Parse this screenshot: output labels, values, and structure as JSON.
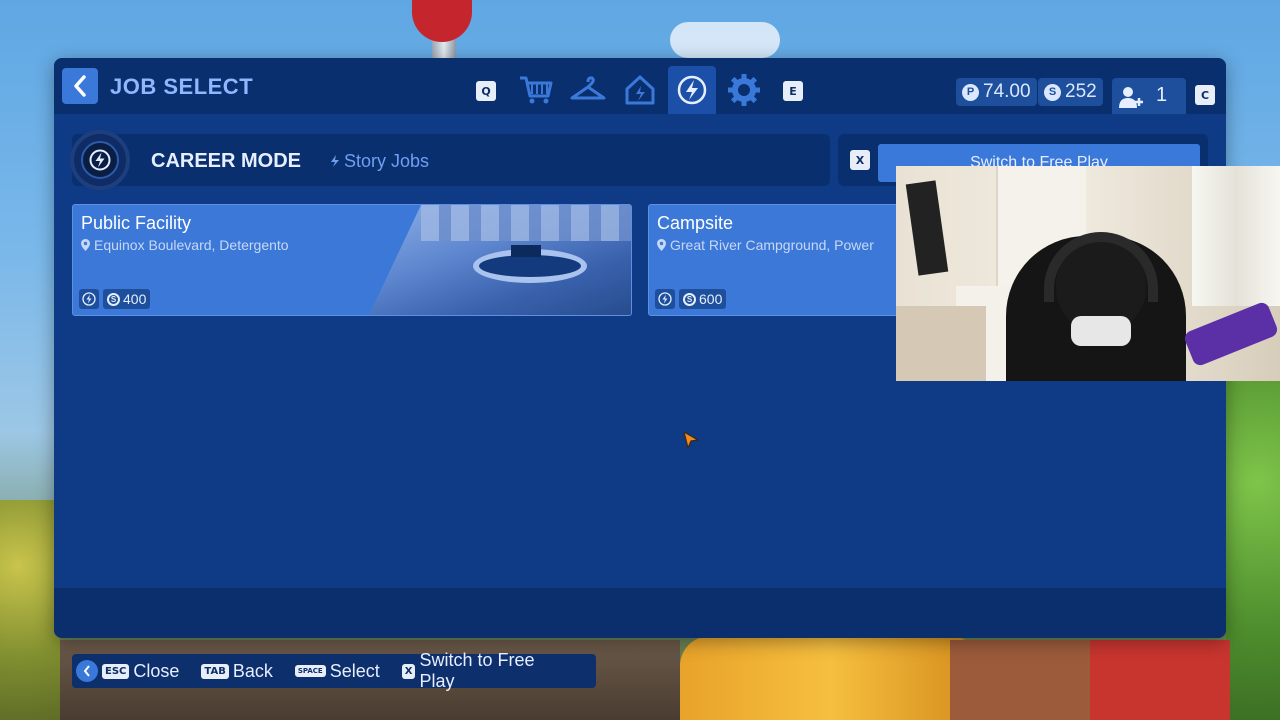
{
  "header": {
    "title": "JOB SELECT",
    "tab_prev_key": "Q",
    "tab_next_key": "E",
    "tabs": [
      {
        "icon": "cart-icon"
      },
      {
        "icon": "hanger-icon"
      },
      {
        "icon": "home-icon"
      },
      {
        "icon": "bolt-icon",
        "active": true
      },
      {
        "icon": "gear-icon"
      }
    ],
    "currency_p": "74.00",
    "currency_s": "252",
    "party_count": "1",
    "party_key": "C"
  },
  "career": {
    "title": "CAREER MODE",
    "subtitle": "Story Jobs",
    "switch_key": "X",
    "switch_label": "Switch to Free Play"
  },
  "jobs": [
    {
      "name": "Public Facility",
      "location": "Equinox Boulevard, Detergento",
      "reward": "400"
    },
    {
      "name": "Campsite",
      "location": "Great River Campground, Power",
      "reward": "600"
    }
  ],
  "hints": [
    {
      "key": "ESC",
      "label": "Close"
    },
    {
      "key": "TAB",
      "label": "Back"
    },
    {
      "key": "SPACE",
      "label": "Select"
    },
    {
      "key": "X",
      "label": "Switch to Free Play"
    }
  ],
  "colors": {
    "panel": "#0f3a86",
    "accent": "#3a78d9",
    "title": "#8fb6ff"
  }
}
